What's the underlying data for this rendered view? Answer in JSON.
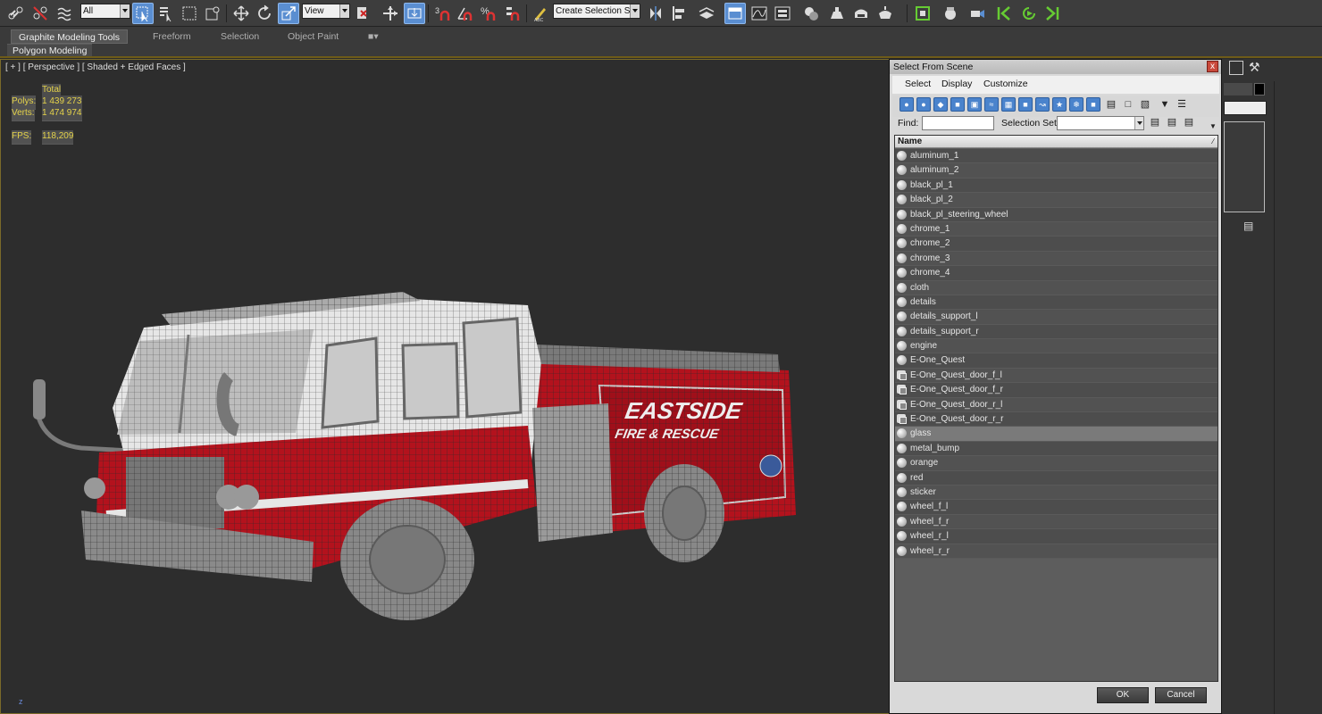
{
  "toolbar": {
    "selection_filter": "All",
    "reference_coord": "View",
    "named_selection_placeholder": "Create Selection Se",
    "icons": [
      "link-icon",
      "unlink-icon",
      "bind-spacewarp-icon",
      "select-object-icon",
      "select-by-name-icon",
      "rect-region-icon",
      "window-crossing-icon",
      "move-icon",
      "rotate-icon",
      "scale-icon",
      "edit-named-sets-icon",
      "pivot-icon",
      "manipulate-icon",
      "snaps-toggle-icon",
      "angle-snap-icon",
      "percent-snap-icon",
      "spinner-snap-icon",
      "mirror-icon",
      "align-icon",
      "layer-manager-icon",
      "graphite-toggle-icon",
      "curve-editor-icon",
      "schematic-view-icon",
      "material-editor-icon",
      "render-setup-icon",
      "rendered-frame-icon",
      "render-icon"
    ]
  },
  "ribbon": {
    "tabs": [
      "Graphite Modeling Tools",
      "Freeform",
      "Selection",
      "Object Paint"
    ],
    "active_tab": "Graphite Modeling Tools",
    "panel_label": "Polygon Modeling"
  },
  "viewport": {
    "label": "[ + ] [ Perspective ] [ Shaded + Edged Faces ]",
    "stats_header": "Total",
    "polys_label": "Polys:",
    "polys_value": "1 439 273",
    "verts_label": "Verts:",
    "verts_value": "1 474 974",
    "fps_label": "FPS:",
    "fps_value": "118,209",
    "truck_text_1": "EASTSIDE",
    "truck_text_2": "FIRE & RESCUE",
    "axis_label": "z"
  },
  "dialog": {
    "title": "Select From Scene",
    "close": "x",
    "menu": [
      "Select",
      "Display",
      "Customize"
    ],
    "find_label": "Find:",
    "find_value": "",
    "selection_set_label": "Selection Set:",
    "selection_set_value": "",
    "column_name": "Name",
    "items": [
      {
        "name": "aluminum_1",
        "type": "object"
      },
      {
        "name": "aluminum_2",
        "type": "object"
      },
      {
        "name": "black_pl_1",
        "type": "object"
      },
      {
        "name": "black_pl_2",
        "type": "object"
      },
      {
        "name": "black_pl_steering_wheel",
        "type": "object"
      },
      {
        "name": "chrome_1",
        "type": "object"
      },
      {
        "name": "chrome_2",
        "type": "object"
      },
      {
        "name": "chrome_3",
        "type": "object"
      },
      {
        "name": "chrome_4",
        "type": "object"
      },
      {
        "name": "cloth",
        "type": "object"
      },
      {
        "name": "details",
        "type": "object"
      },
      {
        "name": "details_support_l",
        "type": "object"
      },
      {
        "name": "details_support_r",
        "type": "object"
      },
      {
        "name": "engine",
        "type": "object"
      },
      {
        "name": "E-One_Quest",
        "type": "object"
      },
      {
        "name": "E-One_Quest_door_f_l",
        "type": "group"
      },
      {
        "name": "E-One_Quest_door_f_r",
        "type": "group"
      },
      {
        "name": "E-One_Quest_door_r_l",
        "type": "group"
      },
      {
        "name": "E-One_Quest_door_r_r",
        "type": "group"
      },
      {
        "name": "glass",
        "type": "object",
        "selected": true
      },
      {
        "name": "metal_bump",
        "type": "object"
      },
      {
        "name": "orange",
        "type": "object"
      },
      {
        "name": "red",
        "type": "object"
      },
      {
        "name": "sticker",
        "type": "object"
      },
      {
        "name": "wheel_f_l",
        "type": "object"
      },
      {
        "name": "wheel_f_r",
        "type": "object"
      },
      {
        "name": "wheel_r_l",
        "type": "object"
      },
      {
        "name": "wheel_r_r",
        "type": "object"
      }
    ],
    "ok_label": "OK",
    "cancel_label": "Cancel"
  },
  "colors": {
    "accent": "#5a8ed1",
    "viewport_border": "#7a6a2a",
    "stats_text": "#e4d24a",
    "truck_red": "#b3121d"
  }
}
